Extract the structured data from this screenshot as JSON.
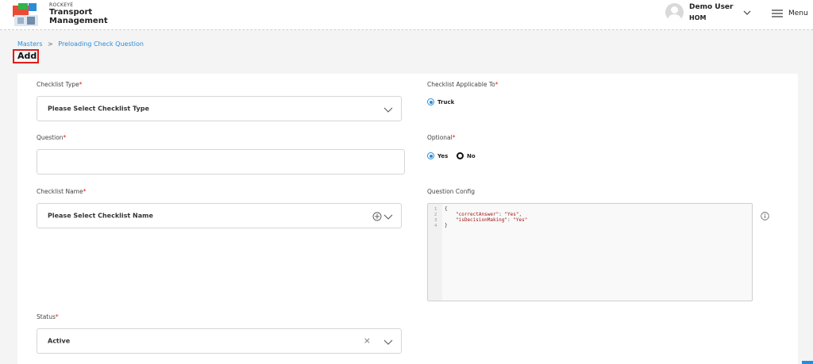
{
  "header": {
    "brand_small": "ROCKEYE",
    "brand_line1": "Transport",
    "brand_line2": "Management",
    "user_name": "Demo User",
    "user_role": "HOM",
    "menu_label": "Menu"
  },
  "breadcrumb": {
    "root": "Masters",
    "separator": ">",
    "current": "Preloading Check Question"
  },
  "page_title": "Add",
  "form": {
    "checklist_type": {
      "label": "Checklist Type",
      "required_mark": "*",
      "placeholder": "Please Select Checklist Type"
    },
    "question": {
      "label": "Question",
      "required_mark": "*",
      "value": ""
    },
    "checklist_name": {
      "label": "Checklist Name",
      "required_mark": "*",
      "placeholder": "Please Select Checklist Name"
    },
    "status": {
      "label": "Status",
      "required_mark": "*",
      "value": "Active",
      "clear_glyph": "×"
    },
    "applicable_to": {
      "label": "Checklist Applicable To",
      "required_mark": "*",
      "options": [
        {
          "label": "Truck",
          "selected": true
        }
      ]
    },
    "optional": {
      "label": "Optional",
      "required_mark": "*",
      "options": [
        {
          "label": "Yes",
          "selected": true
        },
        {
          "label": "No",
          "selected": false
        }
      ]
    },
    "question_config": {
      "label": "Question Config",
      "line_numbers": [
        "1",
        "2",
        "3",
        "4"
      ],
      "line1": "{",
      "line2_key": "\"correctAnswer\"",
      "line2_sep": ": ",
      "line2_val": "\"Yes\"",
      "line2_end": ",",
      "line3_key": "\"isDecisionMaking\"",
      "line3_sep": ": ",
      "line3_val": "\"Yes\"",
      "line4": "}"
    }
  },
  "colors": {
    "accent": "#2a8cd8",
    "required": "#e31b1b",
    "title_outline": "#e31b1b"
  }
}
